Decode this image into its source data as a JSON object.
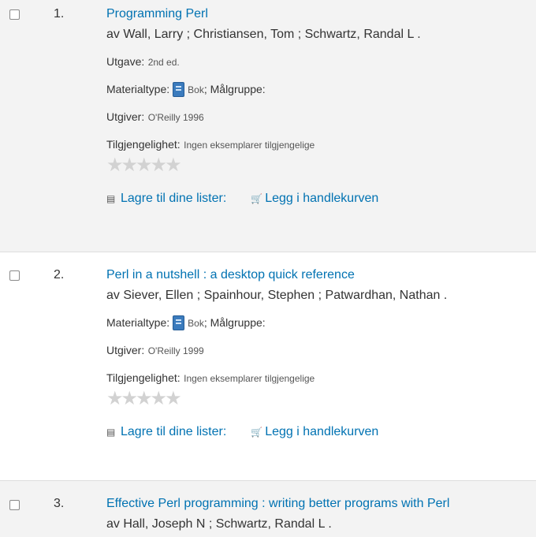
{
  "results": [
    {
      "number": "1.",
      "title": "Programming Perl",
      "authors": "av Wall, Larry ; Christiansen, Tom ; Schwartz, Randal L .",
      "edition_label": "Utgave:",
      "edition_value": "2nd ed.",
      "material_label": "Materialtype:",
      "material_value": "Bok",
      "audience_label": "; Målgruppe:",
      "publisher_label": "Utgiver:",
      "publisher_value": "O'Reilly 1996",
      "availability_label": "Tilgjengelighet:",
      "availability_value": "Ingen eksemplarer tilgjengelige",
      "rating": "★★★★★",
      "save_label": "Lagre til dine lister:",
      "cart_label": "Legg i handlekurven"
    },
    {
      "number": "2.",
      "title": "Perl in a nutshell : a desktop quick reference",
      "authors": "av Siever, Ellen ; Spainhour, Stephen ; Patwardhan, Nathan .",
      "material_label": "Materialtype:",
      "material_value": "Bok",
      "audience_label": "; Målgruppe:",
      "publisher_label": "Utgiver:",
      "publisher_value": "O'Reilly 1999",
      "availability_label": "Tilgjengelighet:",
      "availability_value": "Ingen eksemplarer tilgjengelige",
      "rating": "★★★★★",
      "save_label": "Lagre til dine lister:",
      "cart_label": "Legg i handlekurven"
    },
    {
      "number": "3.",
      "title": "Effective Perl programming : writing better programs with Perl",
      "authors": "av Hall, Joseph N ; Schwartz, Randal L ."
    }
  ],
  "icons": {
    "save": "▤",
    "cart": "🛒"
  },
  "colors": {
    "link": "#0072b2",
    "odd_row": "#f3f3f3"
  }
}
